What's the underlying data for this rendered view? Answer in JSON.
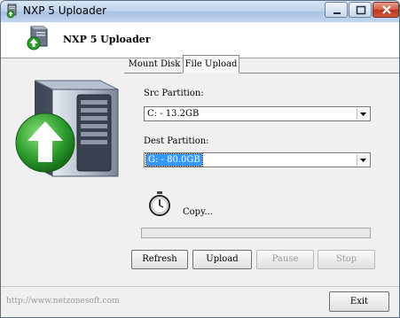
{
  "window": {
    "title": "NXP 5 Uploader"
  },
  "header": {
    "title": "NXP 5 Uploader"
  },
  "tabs": [
    {
      "label": "Mount Disk",
      "selected": false
    },
    {
      "label": "File Upload",
      "selected": true
    }
  ],
  "src": {
    "label": "Src Partition:",
    "value": "C: - 13.2GB"
  },
  "dest": {
    "label": "Dest Partition:",
    "value": "G: - 80.0GB"
  },
  "status": {
    "text": "Copy...",
    "progress": 0
  },
  "buttons": {
    "refresh": "Refresh",
    "upload": "Upload",
    "pause": "Pause",
    "stop": "Stop",
    "exit": "Exit"
  },
  "footer": {
    "url": "http://www.netzonesoft.com"
  },
  "icons": {
    "app": "server-upload-icon",
    "timer": "stopwatch-icon",
    "dropdown": "chevron-down-icon"
  },
  "colors": {
    "selection": "#3399ff",
    "upload_arrow": "#2ea02e",
    "close_button": "#c94b33"
  }
}
